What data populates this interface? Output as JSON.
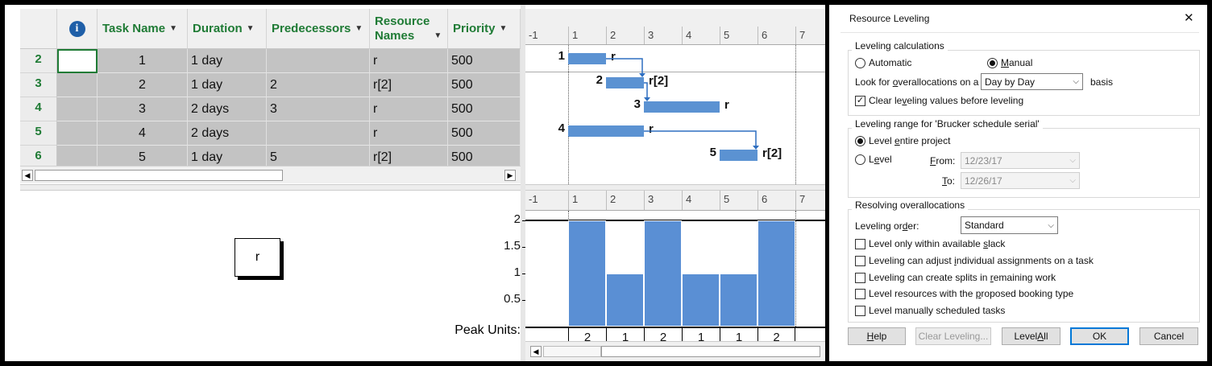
{
  "table": {
    "headers": {
      "info": "i",
      "task_name": "Task Name",
      "duration": "Duration",
      "predecessors": "Predecessors",
      "resource_line1": "Resource",
      "resource_line2": "Names",
      "priority": "Priority"
    },
    "rows": [
      {
        "id": "2",
        "task": "1",
        "duration": "1 day",
        "pred": "",
        "res": "r",
        "prio": "500"
      },
      {
        "id": "3",
        "task": "2",
        "duration": "1 day",
        "pred": "2",
        "res": "r[2]",
        "prio": "500"
      },
      {
        "id": "4",
        "task": "3",
        "duration": "2 days",
        "pred": "3",
        "res": "r",
        "prio": "500"
      },
      {
        "id": "5",
        "task": "4",
        "duration": "2 days",
        "pred": "",
        "res": "r",
        "prio": "500"
      },
      {
        "id": "6",
        "task": "5",
        "duration": "1 day",
        "pred": "5",
        "res": "r[2]",
        "prio": "500"
      }
    ]
  },
  "gantt": {
    "timescale": [
      "-1",
      "1",
      "2",
      "3",
      "4",
      "5",
      "6",
      "7"
    ],
    "bars": [
      {
        "num": "1",
        "res": "r"
      },
      {
        "num": "2",
        "res": "r[2]"
      },
      {
        "num": "3",
        "res": "r"
      },
      {
        "num": "4",
        "res": "r"
      },
      {
        "num": "5",
        "res": "r[2]"
      }
    ]
  },
  "resource_box": {
    "label": "r"
  },
  "histogram": {
    "y_ticks": [
      "2",
      "1.5",
      "1",
      "0.5"
    ],
    "peak_label": "Peak Units:",
    "values": [
      2,
      1,
      2,
      1,
      1,
      2
    ],
    "value_labels": [
      "2",
      "1",
      "2",
      "1",
      "1",
      "2"
    ],
    "ymax": 2,
    "color": "#5a8fd4"
  },
  "dialog": {
    "title": "Resource Leveling",
    "close": "✕",
    "calc": {
      "title": "Leveling calculations",
      "automatic": "Automatic",
      "manual": "Manual",
      "look_pre": "Look for ",
      "look_u": "o",
      "look_post": "verallocations on a",
      "basis_value": "Day by Day",
      "basis_suffix": "basis",
      "clear_pre": "Clear le",
      "clear_u": "v",
      "clear_post": "eling values before leveling"
    },
    "range": {
      "title": "Leveling range for 'Brucker schedule serial'",
      "entire_pre": "Level ",
      "entire_u": "e",
      "entire_post": "ntire project",
      "level_pre": "L",
      "level_u": "e",
      "level_post": "vel",
      "from_u": "F",
      "from_post": "rom:",
      "from_value": "12/23/17",
      "to_u": "T",
      "to_post": "o:",
      "to_value": "12/26/17"
    },
    "resolve": {
      "title": "Resolving overallocations",
      "order_pre": "Leveling or",
      "order_u": "d",
      "order_post": "er:",
      "order_value": "Standard",
      "opt1_pre": "Level only within available ",
      "opt1_u": "s",
      "opt1_post": "lack",
      "opt2_pre": "Leveling can adjust ",
      "opt2_u": "i",
      "opt2_post": "ndividual assignments on a task",
      "opt3_pre": "Leveling can create splits in ",
      "opt3_u": "r",
      "opt3_post": "emaining work",
      "opt4_pre": "Level resources with the ",
      "opt4_u": "p",
      "opt4_post": "roposed booking type",
      "opt5": "Level manually scheduled tasks"
    },
    "buttons": {
      "help_u": "H",
      "help_post": "elp",
      "clear": "Clear Leveling...",
      "levelall_pre": "Level ",
      "levelall_u": "A",
      "levelall_post": "ll",
      "ok": "OK",
      "cancel": "Cancel"
    }
  }
}
